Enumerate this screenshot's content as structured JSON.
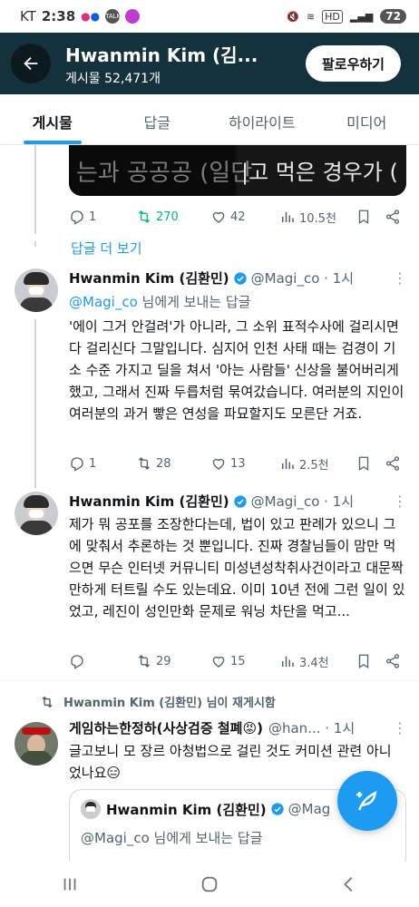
{
  "status_bar": {
    "carrier": "KT",
    "time": "2:38",
    "talk_badge": "TALK",
    "battery": "72"
  },
  "header": {
    "name": "Hwanmin Kim (김...",
    "post_count": "게시물 52,471개",
    "follow_label": "팔로우하기"
  },
  "tabs": [
    {
      "label": "게시물",
      "active": true
    },
    {
      "label": "답글",
      "active": false
    },
    {
      "label": "하이라이트",
      "active": false
    },
    {
      "label": "미디어",
      "active": false
    }
  ],
  "media_post": {
    "image_text_left": "는과 공공공 (일단",
    "image_text_right": "|고 먹은 경우가 (",
    "actions": {
      "replies": "1",
      "retweets": "270",
      "likes": "42",
      "views": "10.5천"
    }
  },
  "more_replies_label": "답글 더 보기",
  "tweets": [
    {
      "display_name": "Hwanmin Kim (김환민)",
      "handle": "@Magi_co · 1시",
      "reply_to_handle": "@Magi_co",
      "reply_to_suffix": " 님에게 보내는 답글",
      "text": "'에이 그거 안걸려'가 아니라, 그 소위 표적수사에 걸리시면 다 걸리신다 그말입니다. 심지어 인천 사태 때는 검경이 기소 수준 가지고 딜을 쳐서 '아는 사람들' 신상을 불어버리게 했고, 그래서 진짜 두릅처럼 묶여갔습니다. 여러분의 지인이 여러분의 과거 빻은 연성을 파묘할지도 모른단 거죠.",
      "actions": {
        "replies": "1",
        "retweets": "28",
        "likes": "13",
        "views": "2.5천"
      }
    },
    {
      "display_name": "Hwanmin Kim (김환민)",
      "handle": "@Magi_co · 1시",
      "text": "제가 뭐 공포를 조장한다는데, 법이 있고 판례가 있으니 그에 맞춰서 추론하는 것 뿐입니다. 진짜 경찰님들이 맘만 먹으면 무슨 인터넷 커뮤니티 미성년성착취사건이라고 대문짝만하게 터트릴 수도 있는데요. 이미 10년 전에 그런 일이 있었고, 레진이 성인만화 문제로 워닝 차단을 먹고...",
      "actions": {
        "replies": "",
        "retweets": "29",
        "likes": "15",
        "views": "3.4천"
      }
    }
  ],
  "retweet_notice": "Hwanmin Kim (김환민) 님이 재게시함",
  "retweeted_tweet": {
    "display_name": "게임하는한정하(사상검증 철폐😡)",
    "handle": "@han... · 1시",
    "text": "글고보니 모 장르 아청법으로 걸린 것도 커미션 관련 아니었나요😑",
    "quote": {
      "display_name": "Hwanmin Kim (김환민)",
      "handle": "@Mag",
      "reply_to_handle": "@Magi_co",
      "reply_to_suffix": " 님에게 보내는 답글"
    }
  },
  "colors": {
    "accent": "#1d9bf0",
    "header_bg": "#14323b",
    "retweet_green": "#00ba7c"
  }
}
